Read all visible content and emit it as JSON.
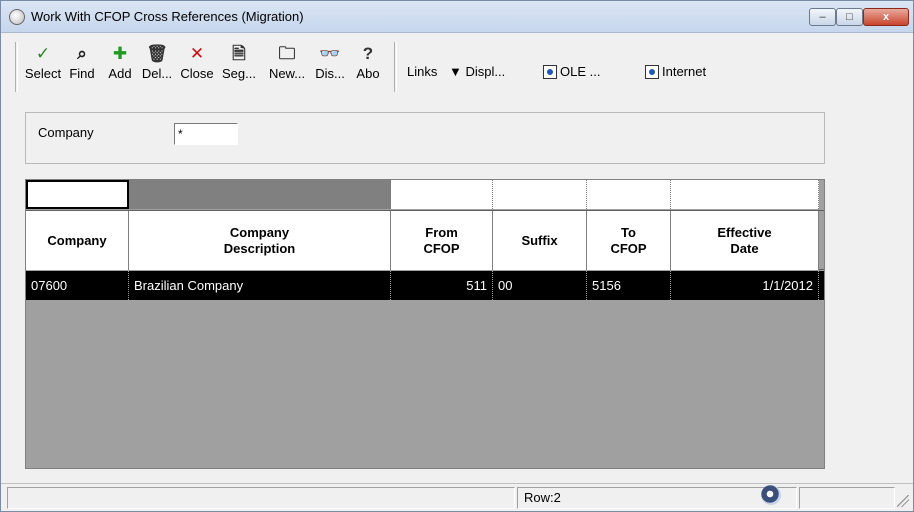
{
  "window": {
    "title": "Work With CFOP Cross References (Migration)",
    "controls": {
      "minimize": "–",
      "maximize": "□",
      "close": "x"
    }
  },
  "toolbar": {
    "buttons": [
      {
        "id": "select",
        "label": "Select",
        "icon": "checkmark-icon",
        "color": "#1e8c1e"
      },
      {
        "id": "find",
        "label": "Find",
        "icon": "find-icon",
        "color": "#222222"
      },
      {
        "id": "add",
        "label": "Add",
        "icon": "plus-icon",
        "color": "#1e9a1e"
      },
      {
        "id": "delete",
        "label": "Del...",
        "icon": "trash-icon",
        "color": "#333333"
      },
      {
        "id": "close",
        "label": "Close",
        "icon": "x-icon",
        "color": "#d01010"
      },
      {
        "id": "segments",
        "label": "Seg...",
        "icon": "document-icon",
        "color": "#333333"
      },
      {
        "id": "new",
        "label": "New...",
        "icon": "new-folder-icon",
        "color": "#333333"
      },
      {
        "id": "display",
        "label": "Dis...",
        "icon": "glasses-icon",
        "color": "#333333"
      },
      {
        "id": "about",
        "label": "Abo",
        "icon": "pointer-help-icon",
        "color": "#333333"
      }
    ],
    "links": [
      {
        "label": "Links"
      },
      {
        "label": "Displ...",
        "icon": "triangle-down-icon"
      },
      {
        "label": "OLE ...",
        "icon": "ole-icon"
      },
      {
        "label": "Internet",
        "icon": "internet-icon"
      }
    ]
  },
  "header": {
    "company_label": "Company",
    "company_value": "*"
  },
  "grid": {
    "columns": [
      {
        "label": "Company"
      },
      {
        "label": "Company\nDescription"
      },
      {
        "label": "From\nCFOP"
      },
      {
        "label": "Suffix"
      },
      {
        "label": "To\nCFOP"
      },
      {
        "label": "Effective\nDate"
      }
    ],
    "rows": [
      {
        "company": "07600",
        "description": "Brazilian Company",
        "from_cfop": "511",
        "suffix": "00",
        "to_cfop": "5156",
        "effective_date": "1/1/2012"
      }
    ]
  },
  "status": {
    "row_text": "Row:2"
  },
  "colors": {
    "selected_row_bg": "#000000",
    "grid_bg": "#a0a0a0",
    "qbe_dark_cell": "#808080"
  }
}
